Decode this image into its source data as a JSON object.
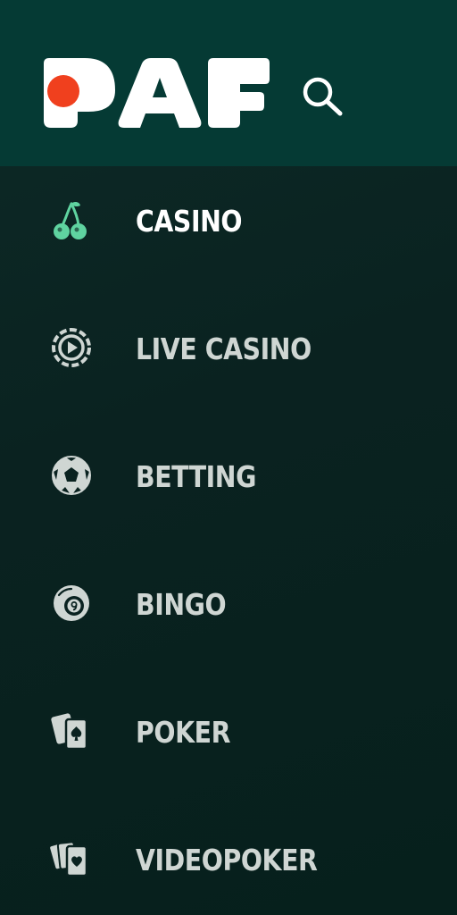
{
  "header": {
    "logo_text": "PAF",
    "search_icon": "search-icon"
  },
  "colors": {
    "header_bg": "#053a34",
    "menu_bg": "#0a2220",
    "accent_green": "#5fd3a0",
    "logo_dot": "#f0401e",
    "text_active": "#ffffff",
    "text_default": "#cfd6d3"
  },
  "nav": {
    "items": [
      {
        "label": "CASINO",
        "icon": "cherry-icon",
        "active": true
      },
      {
        "label": "LIVE CASINO",
        "icon": "live-chip-icon",
        "active": false
      },
      {
        "label": "BETTING",
        "icon": "soccer-ball-icon",
        "active": false
      },
      {
        "label": "BINGO",
        "icon": "bingo-ball-icon",
        "active": false
      },
      {
        "label": "POKER",
        "icon": "poker-cards-icon",
        "active": false
      },
      {
        "label": "VIDEOPOKER",
        "icon": "videopoker-cards-icon",
        "active": false
      }
    ]
  }
}
